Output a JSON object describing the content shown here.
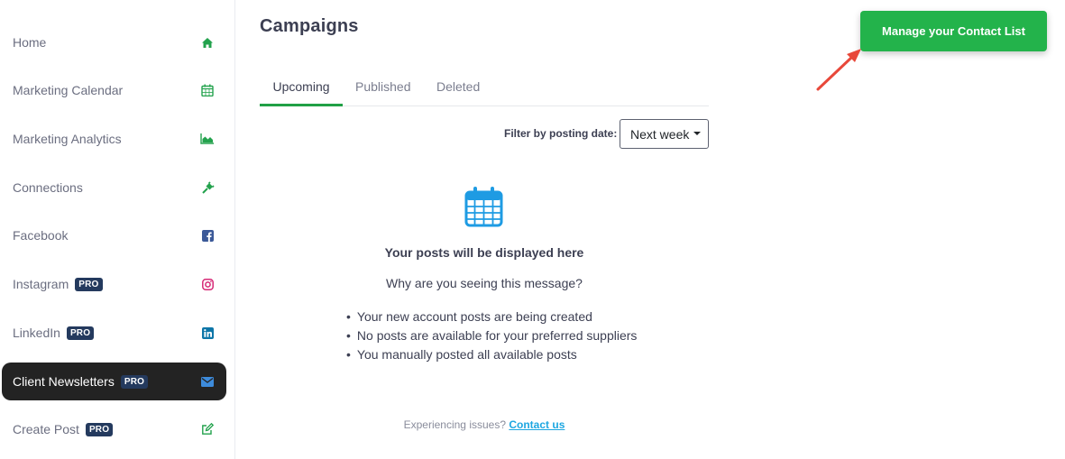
{
  "sidebar": {
    "items": [
      {
        "label": "Home",
        "pro": "",
        "icon": "home-icon"
      },
      {
        "label": "Marketing Calendar",
        "pro": "",
        "icon": "calendar-icon"
      },
      {
        "label": "Marketing Analytics",
        "pro": "",
        "icon": "area-chart-icon"
      },
      {
        "label": "Connections",
        "pro": "",
        "icon": "plug-icon"
      },
      {
        "label": "Facebook",
        "pro": "",
        "icon": "facebook-icon"
      },
      {
        "label": "Instagram",
        "pro": "PRO",
        "icon": "instagram-icon"
      },
      {
        "label": "LinkedIn",
        "pro": "PRO",
        "icon": "linkedin-icon"
      },
      {
        "label": "Client Newsletters",
        "pro": "PRO",
        "icon": "envelope-icon",
        "active": true
      },
      {
        "label": "Create Post",
        "pro": "PRO",
        "icon": "edit-icon"
      }
    ]
  },
  "main": {
    "title": "Campaigns",
    "tabs": [
      {
        "label": "Upcoming",
        "active": true
      },
      {
        "label": "Published",
        "active": false
      },
      {
        "label": "Deleted",
        "active": false
      }
    ],
    "filter": {
      "label": "Filter by posting date:",
      "value": "Next week"
    },
    "empty": {
      "title": "Your posts will be displayed here",
      "why": "Why are you seeing this message?",
      "reasons": [
        "Your new account posts are being created",
        "No posts are available for your preferred suppliers",
        "You manually posted all available posts"
      ]
    },
    "issues": {
      "text": "Experiencing issues?",
      "link": "Contact us"
    }
  },
  "cta": {
    "label": "Manage your Contact List"
  },
  "colors": {
    "accent_green": "#23b34b",
    "tab_underline": "#21a046",
    "active_nav_bg": "#232323",
    "pro_badge": "#243a5e",
    "link": "#1ea7e1",
    "calendar_icon": "#1e9be3",
    "annotation_arrow": "#e8483a"
  }
}
